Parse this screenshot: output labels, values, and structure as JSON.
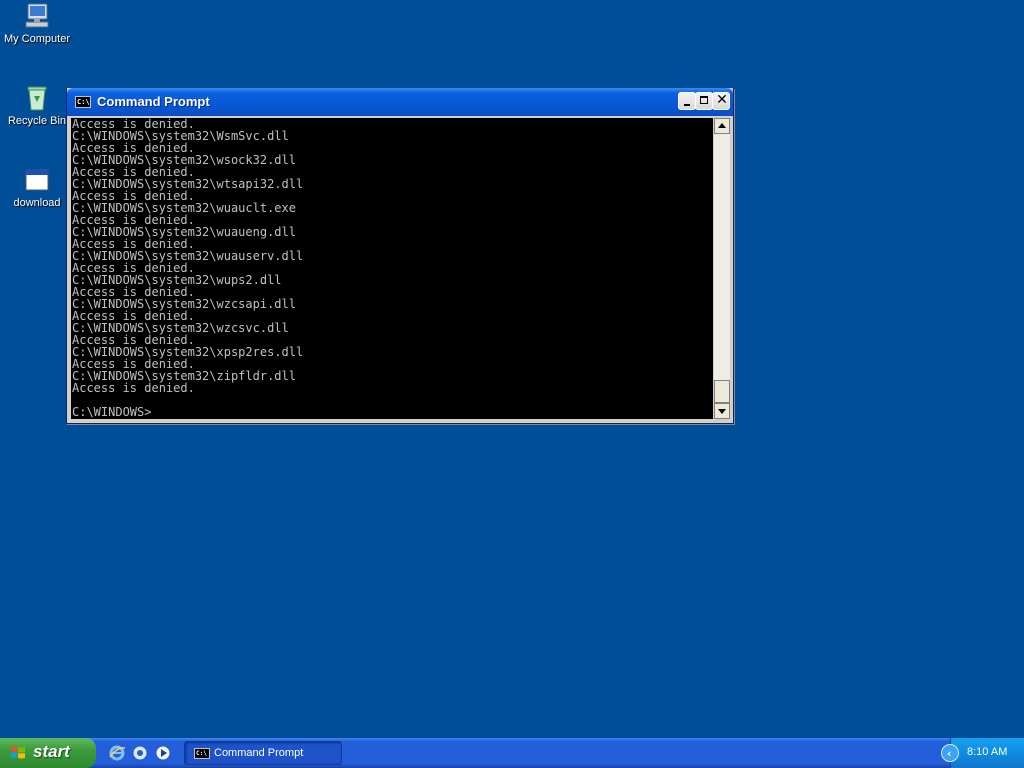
{
  "desktop": {
    "icons": [
      {
        "label": "My Computer",
        "icon": "my-computer-icon"
      },
      {
        "label": "Recycle Bin",
        "icon": "recycle-bin-icon"
      },
      {
        "label": "download",
        "icon": "window-file-icon"
      }
    ],
    "background_color": "#004e98"
  },
  "window": {
    "title": "Command Prompt",
    "title_icon_text": "C:\\",
    "controls": {
      "minimize": "minimize-icon",
      "maximize": "maximize-icon",
      "close": "close-icon"
    },
    "console_lines": [
      "Access is denied.",
      "C:\\WINDOWS\\system32\\WsmSvc.dll",
      "Access is denied.",
      "C:\\WINDOWS\\system32\\wsock32.dll",
      "Access is denied.",
      "C:\\WINDOWS\\system32\\wtsapi32.dll",
      "Access is denied.",
      "C:\\WINDOWS\\system32\\wuauclt.exe",
      "Access is denied.",
      "C:\\WINDOWS\\system32\\wuaueng.dll",
      "Access is denied.",
      "C:\\WINDOWS\\system32\\wuauserv.dll",
      "Access is denied.",
      "C:\\WINDOWS\\system32\\wups2.dll",
      "Access is denied.",
      "C:\\WINDOWS\\system32\\wzcsapi.dll",
      "Access is denied.",
      "C:\\WINDOWS\\system32\\wzcsvc.dll",
      "Access is denied.",
      "C:\\WINDOWS\\system32\\xpsp2res.dll",
      "Access is denied.",
      "C:\\WINDOWS\\system32\\zipfldr.dll",
      "Access is denied."
    ],
    "prompt": "C:\\WINDOWS>",
    "colors": {
      "console_bg": "#000000",
      "console_text": "#c0c0c0",
      "title_bar": "#0858d6"
    }
  },
  "taskbar": {
    "start_label": "start",
    "quick_launch": [
      "internet-explorer-icon",
      "media-icon",
      "player-icon"
    ],
    "tasks": [
      {
        "label": "Command Prompt",
        "icon_text": "C:\\"
      }
    ],
    "clock": "8:10 AM"
  }
}
